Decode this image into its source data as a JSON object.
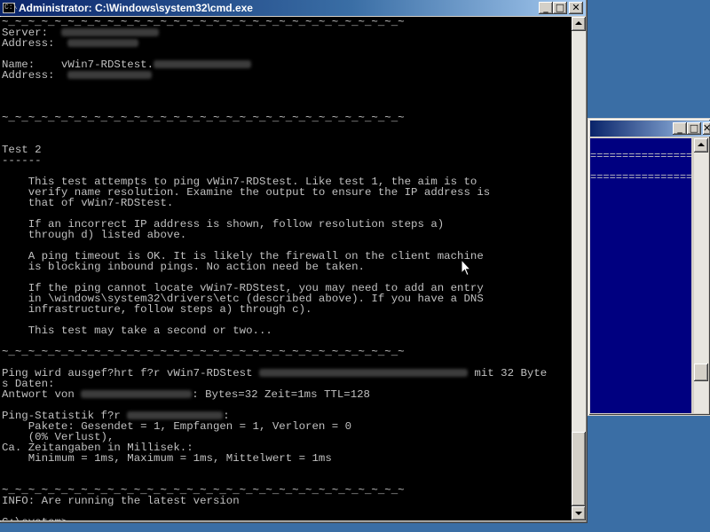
{
  "window": {
    "title": "Administrator: C:\\Windows\\system32\\cmd.exe",
    "icon_text": "C:\\",
    "buttons": {
      "minimize": "_",
      "maximize": "□",
      "close": "✕"
    }
  },
  "bg_window": {
    "buttons": {
      "minimize": "_",
      "maximize": "□",
      "close": "✕"
    },
    "lines": [
      "================",
      "================"
    ]
  },
  "console": {
    "lines": [
      {
        "parts": [
          {
            "t": "~_~_~_~_~_~_~_~_~_~_~_~_~_~_~_~_~_~_~_~_~_~_~_~_~_~_~_~_~_~_~"
          }
        ]
      },
      {
        "parts": [
          {
            "t": "Server:  "
          },
          {
            "blur": true,
            "w": 110
          }
        ]
      },
      {
        "parts": [
          {
            "t": "Address:  "
          },
          {
            "blur": true,
            "w": 80
          }
        ]
      },
      {
        "parts": []
      },
      {
        "parts": [
          {
            "t": "Name:    vWin7-RDStest."
          },
          {
            "blur": true,
            "w": 110
          }
        ]
      },
      {
        "parts": [
          {
            "t": "Address:  "
          },
          {
            "blur": true,
            "w": 95
          }
        ]
      },
      {
        "parts": []
      },
      {
        "parts": []
      },
      {
        "parts": []
      },
      {
        "parts": [
          {
            "t": "~_~_~_~_~_~_~_~_~_~_~_~_~_~_~_~_~_~_~_~_~_~_~_~_~_~_~_~_~_~_~"
          }
        ]
      },
      {
        "parts": []
      },
      {
        "parts": []
      },
      {
        "parts": [
          {
            "t": "Test 2"
          }
        ]
      },
      {
        "parts": [
          {
            "t": "------"
          }
        ]
      },
      {
        "parts": []
      },
      {
        "parts": [
          {
            "t": "    This test attempts to ping vWin7-RDStest. Like test 1, the aim is to"
          }
        ]
      },
      {
        "parts": [
          {
            "t": "    verify name resolution. Examine the output to ensure the IP address is"
          }
        ]
      },
      {
        "parts": [
          {
            "t": "    that of vWin7-RDStest."
          }
        ]
      },
      {
        "parts": []
      },
      {
        "parts": [
          {
            "t": "    If an incorrect IP address is shown, follow resolution steps a)"
          }
        ]
      },
      {
        "parts": [
          {
            "t": "    through d) listed above."
          }
        ]
      },
      {
        "parts": []
      },
      {
        "parts": [
          {
            "t": "    A ping timeout is OK. It is likely the firewall on the client machine"
          }
        ]
      },
      {
        "parts": [
          {
            "t": "    is blocking inbound pings. No action need be taken."
          }
        ]
      },
      {
        "parts": []
      },
      {
        "parts": [
          {
            "t": "    If the ping cannot locate vWin7-RDStest, you may need to add an entry"
          }
        ]
      },
      {
        "parts": [
          {
            "t": "    in \\windows\\system32\\drivers\\etc (described above). If you have a DNS"
          }
        ]
      },
      {
        "parts": [
          {
            "t": "    infrastructure, follow steps a) through c)."
          }
        ]
      },
      {
        "parts": []
      },
      {
        "parts": [
          {
            "t": "    This test may take a second or two..."
          }
        ]
      },
      {
        "parts": []
      },
      {
        "parts": [
          {
            "t": "~_~_~_~_~_~_~_~_~_~_~_~_~_~_~_~_~_~_~_~_~_~_~_~_~_~_~_~_~_~_~"
          }
        ]
      },
      {
        "parts": []
      },
      {
        "parts": [
          {
            "t": "Ping wird ausgef?hrt f?r vWin7-RDStest "
          },
          {
            "blur": true,
            "w": 235
          },
          {
            "t": " mit 32 Byte"
          }
        ]
      },
      {
        "parts": [
          {
            "t": "s Daten:"
          }
        ]
      },
      {
        "parts": [
          {
            "t": "Antwort von "
          },
          {
            "blur": true,
            "w": 125
          },
          {
            "t": ": Bytes=32 Zeit=1ms TTL=128"
          }
        ]
      },
      {
        "parts": []
      },
      {
        "parts": [
          {
            "t": "Ping-Statistik f?r "
          },
          {
            "blur": true,
            "w": 108
          },
          {
            "t": ":"
          }
        ]
      },
      {
        "parts": [
          {
            "t": "    Pakete: Gesendet = 1, Empfangen = 1, Verloren = 0"
          }
        ]
      },
      {
        "parts": [
          {
            "t": "    (0% Verlust),"
          }
        ]
      },
      {
        "parts": [
          {
            "t": "Ca. Zeitangaben in Millisek.:"
          }
        ]
      },
      {
        "parts": [
          {
            "t": "    Minimum = 1ms, Maximum = 1ms, Mittelwert = 1ms"
          }
        ]
      },
      {
        "parts": []
      },
      {
        "parts": []
      },
      {
        "parts": [
          {
            "t": "~_~_~_~_~_~_~_~_~_~_~_~_~_~_~_~_~_~_~_~_~_~_~_~_~_~_~_~_~_~_~"
          }
        ]
      },
      {
        "parts": [
          {
            "t": "INFO: Are running the latest version"
          }
        ]
      },
      {
        "parts": []
      },
      {
        "parts": [
          {
            "t": "C:\\system>"
          },
          {
            "cursor": true
          }
        ]
      }
    ]
  }
}
